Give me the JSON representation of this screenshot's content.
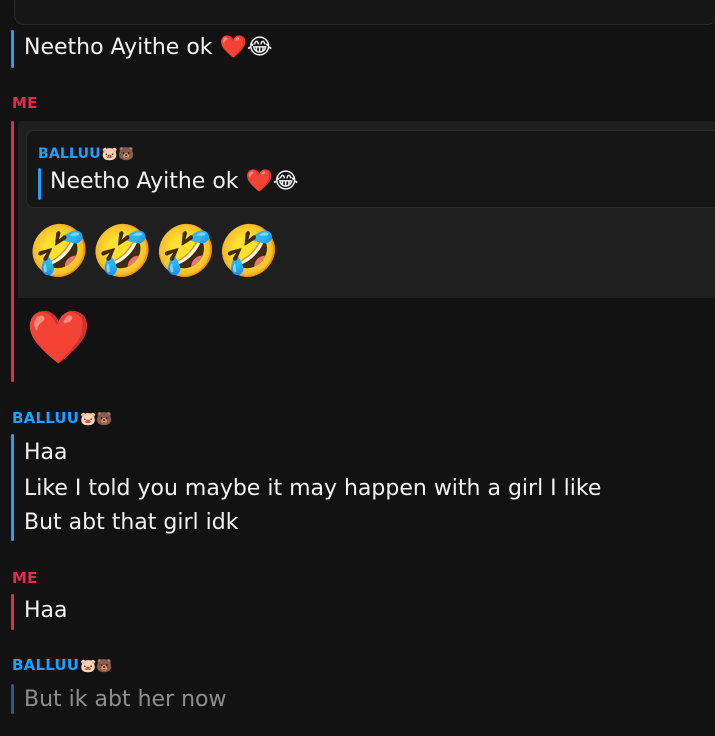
{
  "messages": [
    {
      "id": "top",
      "sender": "",
      "lines": [
        "Neetho Ayithe ok ❤️😂"
      ]
    },
    {
      "id": "me-1",
      "sender": "ME",
      "quoted": {
        "sender": "BALLUU",
        "sender_emojis": "🐷🐻",
        "text": "Neetho Ayithe ok ❤️😂"
      },
      "reply_emojis": "🤣🤣🤣🤣",
      "followup": "❤️"
    },
    {
      "id": "balluu-1",
      "sender": "BALLUU",
      "sender_emojis": "🐷🐻",
      "lines": [
        "Haa",
        "Like I told you maybe it may happen with a girl I like",
        "But abt that girl idk"
      ]
    },
    {
      "id": "me-2",
      "sender": "ME",
      "lines": [
        "Haa"
      ]
    },
    {
      "id": "balluu-2",
      "sender": "BALLUU",
      "sender_emojis": "🐷🐻",
      "lines": [
        "But ik abt her now"
      ]
    }
  ],
  "colors": {
    "me_accent": "#e8294f",
    "balluu_accent": "#1ea0ff",
    "background": "#121212"
  }
}
